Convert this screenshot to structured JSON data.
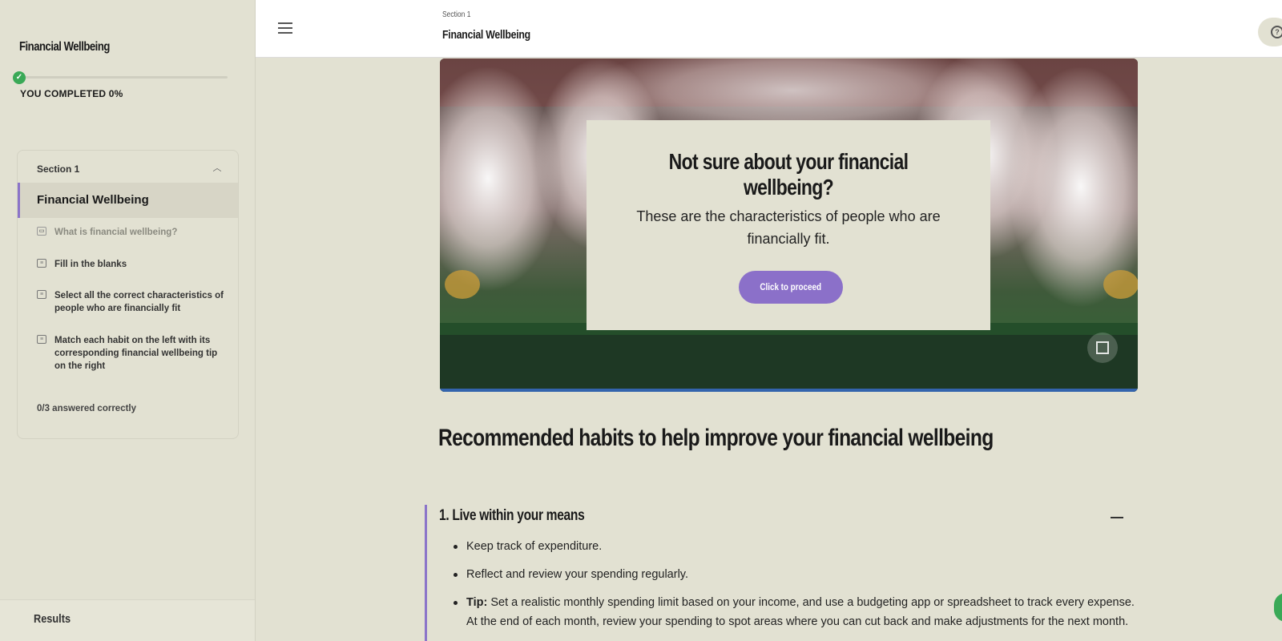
{
  "sidebar": {
    "brand": "Financial Wellbeing",
    "progress": {
      "percent": 0,
      "label": "YOU COMPLETED 0%"
    },
    "section": {
      "label": "Section 1",
      "active_lesson": "Financial Wellbeing",
      "items": [
        {
          "label": "What is financial wellbeing?",
          "icon": "book-icon"
        },
        {
          "label": "Fill in the blanks",
          "icon": "quiz-icon"
        },
        {
          "label": "Select all the correct characteristics of people who are financially fit",
          "icon": "quiz-icon"
        },
        {
          "label": "Match each habit on the left with its corresponding financial wellbeing tip on the right",
          "icon": "quiz-icon"
        }
      ],
      "score": "0/3 answered correctly"
    },
    "results_label": "Results"
  },
  "topbar": {
    "section_label": "Section 1",
    "title": "Financial Wellbeing"
  },
  "hero": {
    "title": "Not sure about your financial wellbeing?",
    "subtitle": "These are the characteristics of people who are financially fit.",
    "button": "Click to proceed"
  },
  "habits": {
    "heading": "Recommended habits to help improve your financial wellbeing",
    "accordion": {
      "title": "1. Live within your means",
      "bullets": [
        "Keep track of expenditure.",
        "Reflect and review your spending regularly."
      ],
      "tip_label": "Tip:",
      "tip_text": " Set a realistic monthly spending limit based on your income, and use a budgeting app or spreadsheet to track every expense. At the end of each month, review your spending to spot areas where you can cut back and make adjustments for the next month."
    }
  },
  "colors": {
    "background": "#e2e1d2",
    "accent": "#8b74c9",
    "success": "#3aa957"
  }
}
